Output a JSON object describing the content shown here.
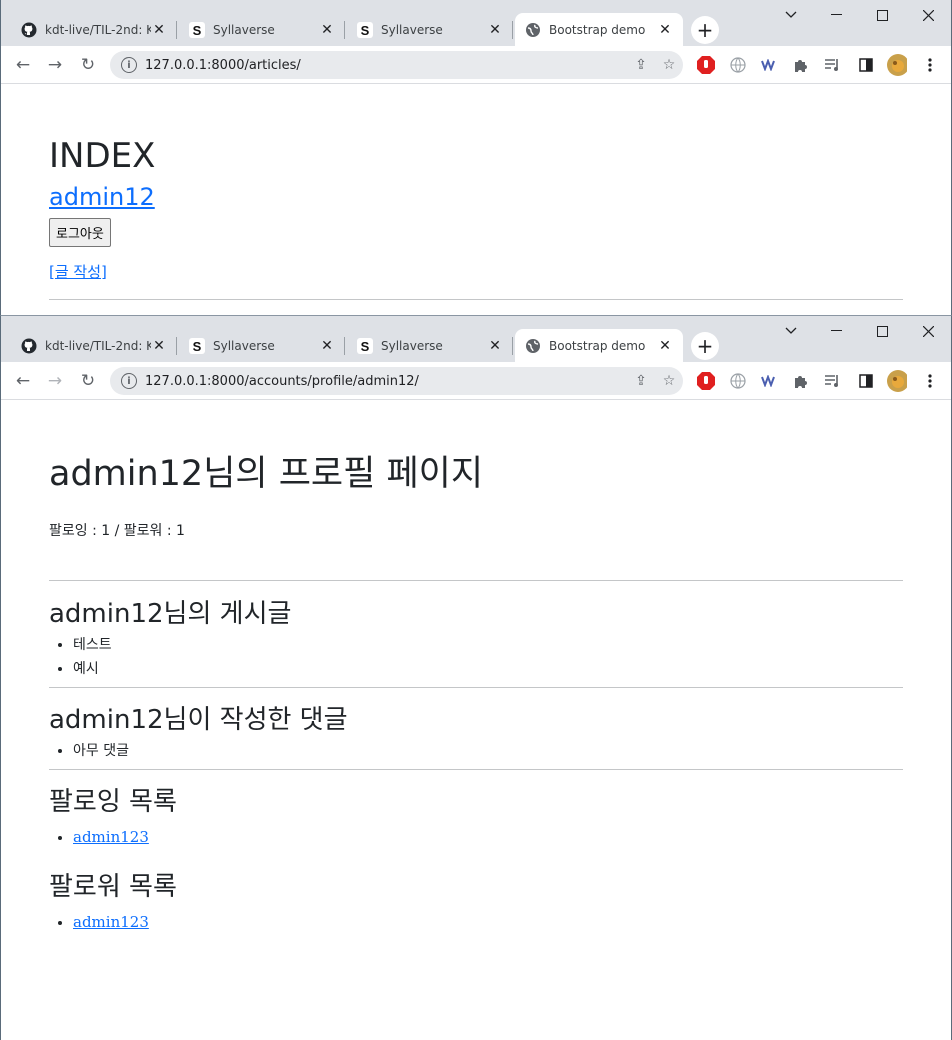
{
  "browser1": {
    "tabs": [
      {
        "title": "kdt-live/TIL-2nd: KD",
        "icon": "github-icon"
      },
      {
        "title": "Syllaverse",
        "icon": "syllaverse-icon"
      },
      {
        "title": "Syllaverse",
        "icon": "syllaverse-icon"
      },
      {
        "title": "Bootstrap demo",
        "icon": "globe-icon"
      }
    ],
    "url": "127.0.0.1:8000/articles/"
  },
  "browser2": {
    "tabs": [
      {
        "title": "kdt-live/TIL-2nd: KD",
        "icon": "github-icon"
      },
      {
        "title": "Syllaverse",
        "icon": "syllaverse-icon"
      },
      {
        "title": "Syllaverse",
        "icon": "syllaverse-icon"
      },
      {
        "title": "Bootstrap demo",
        "icon": "globe-icon"
      }
    ],
    "url": "127.0.0.1:8000/accounts/profile/admin12/"
  },
  "index_page": {
    "heading": "INDEX",
    "username": "admin12",
    "logout_label": "로그아웃",
    "create_link": "[글 작성]"
  },
  "profile_page": {
    "heading": "admin12님의 프로필 페이지",
    "follow_info": "팔로잉 : 1 / 팔로워 : 1",
    "articles_heading": "admin12님의 게시글",
    "articles": [
      "테스트",
      "예시"
    ],
    "comments_heading": "admin12님이 작성한 댓글",
    "comments": [
      "아무 댓글"
    ],
    "followings_heading": "팔로잉 목록",
    "followings": [
      "admin123"
    ],
    "followers_heading": "팔로워 목록",
    "followers": [
      "admin123"
    ]
  }
}
